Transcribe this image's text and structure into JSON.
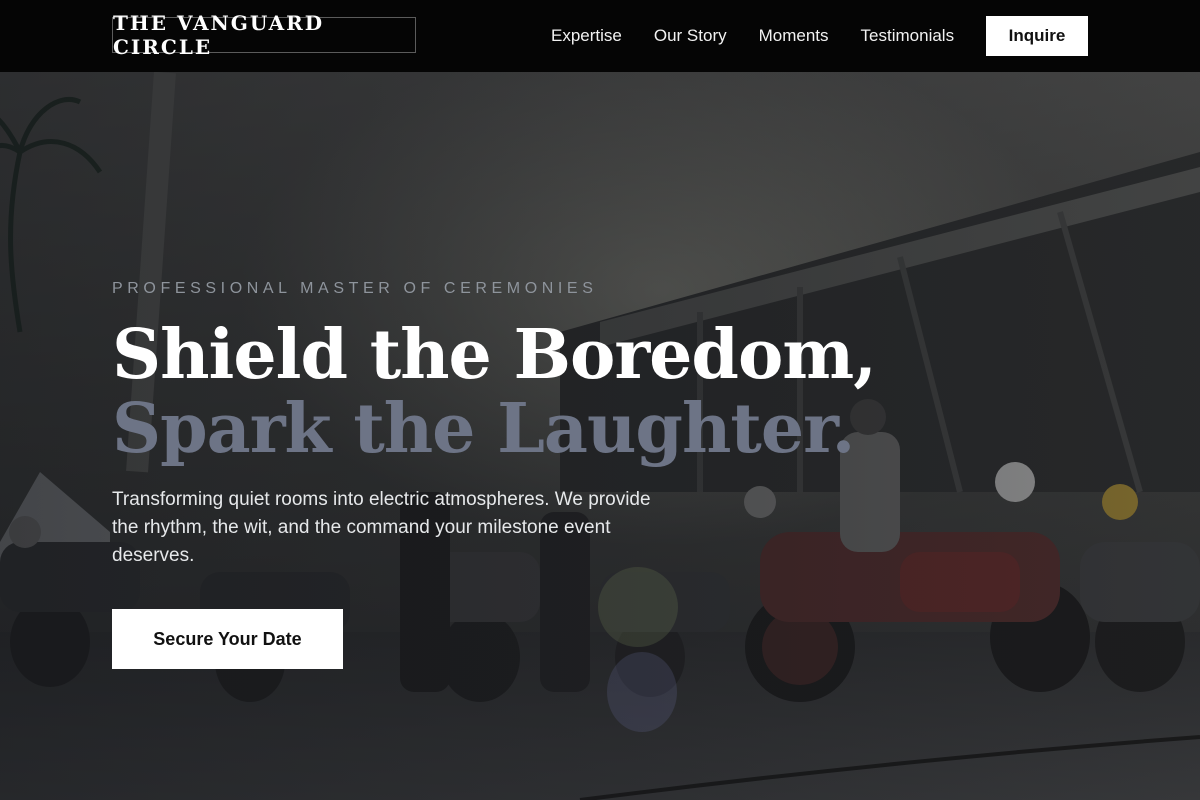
{
  "brand": {
    "logo_text": "THE VANGUARD CIRCLE"
  },
  "nav": {
    "links": [
      {
        "label": "Expertise"
      },
      {
        "label": "Our Story"
      },
      {
        "label": "Moments"
      },
      {
        "label": "Testimonials"
      }
    ],
    "cta_label": "Inquire"
  },
  "hero": {
    "eyebrow": "PROFESSIONAL MASTER OF CEREMONIES",
    "headline_line1": "Shield the Boredom,",
    "headline_line2": "Spark the Laughter.",
    "subtext": "Transforming quiet rooms into electric atmospheres. We provide the rhythm, the wit, and the command your milestone event deserves.",
    "cta_label": "Secure Your Date",
    "background_description_icon": "photo-motorcycles-stadium"
  },
  "colors": {
    "nav_bg": "#050505",
    "accent_white": "#ffffff",
    "headline_muted": "#6d7486",
    "eyebrow": "#8e949c"
  }
}
